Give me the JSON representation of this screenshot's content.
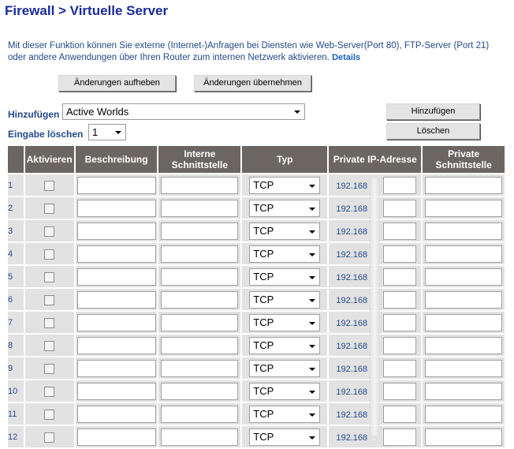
{
  "page": {
    "title": "Firewall > Virtuelle Server",
    "description": "Mit dieser Funktion können Sie externe (Internet-)Anfragen bei Diensten wie Web-Server(Port 80), FTP-Server (Port 21) oder andere Anwendungen über Ihren Router zum internen Netzwerk aktivieren.",
    "details_link": "Details"
  },
  "buttons": {
    "clear": "Änderungen aufheben",
    "apply": "Änderungen übernehmen",
    "add": "Hinzufügen",
    "delete": "Löschen"
  },
  "form": {
    "add_label": "Hinzufügen",
    "add_selected": "Active Worlds",
    "delete_label": "Eingabe löschen",
    "delete_selected": "1"
  },
  "table": {
    "headers": {
      "num": "",
      "enable": "Aktivieren",
      "description": "Beschreibung",
      "internal_port": "Interne Schnittstelle",
      "type": "Typ",
      "private_ip": "Private IP-Adresse",
      "private_port": "Private Schnittstelle"
    },
    "rows": [
      {
        "num": "1",
        "type": "TCP",
        "ip_prefix": "192.168"
      },
      {
        "num": "2",
        "type": "TCP",
        "ip_prefix": "192.168"
      },
      {
        "num": "3",
        "type": "TCP",
        "ip_prefix": "192.168"
      },
      {
        "num": "4",
        "type": "TCP",
        "ip_prefix": "192.168"
      },
      {
        "num": "5",
        "type": "TCP",
        "ip_prefix": "192.168"
      },
      {
        "num": "6",
        "type": "TCP",
        "ip_prefix": "192.168"
      },
      {
        "num": "7",
        "type": "TCP",
        "ip_prefix": "192.168"
      },
      {
        "num": "8",
        "type": "TCP",
        "ip_prefix": "192.168"
      },
      {
        "num": "9",
        "type": "TCP",
        "ip_prefix": "192.168"
      },
      {
        "num": "10",
        "type": "TCP",
        "ip_prefix": "192.168"
      },
      {
        "num": "11",
        "type": "TCP",
        "ip_prefix": "192.168"
      },
      {
        "num": "12",
        "type": "TCP",
        "ip_prefix": "192.168"
      }
    ]
  }
}
